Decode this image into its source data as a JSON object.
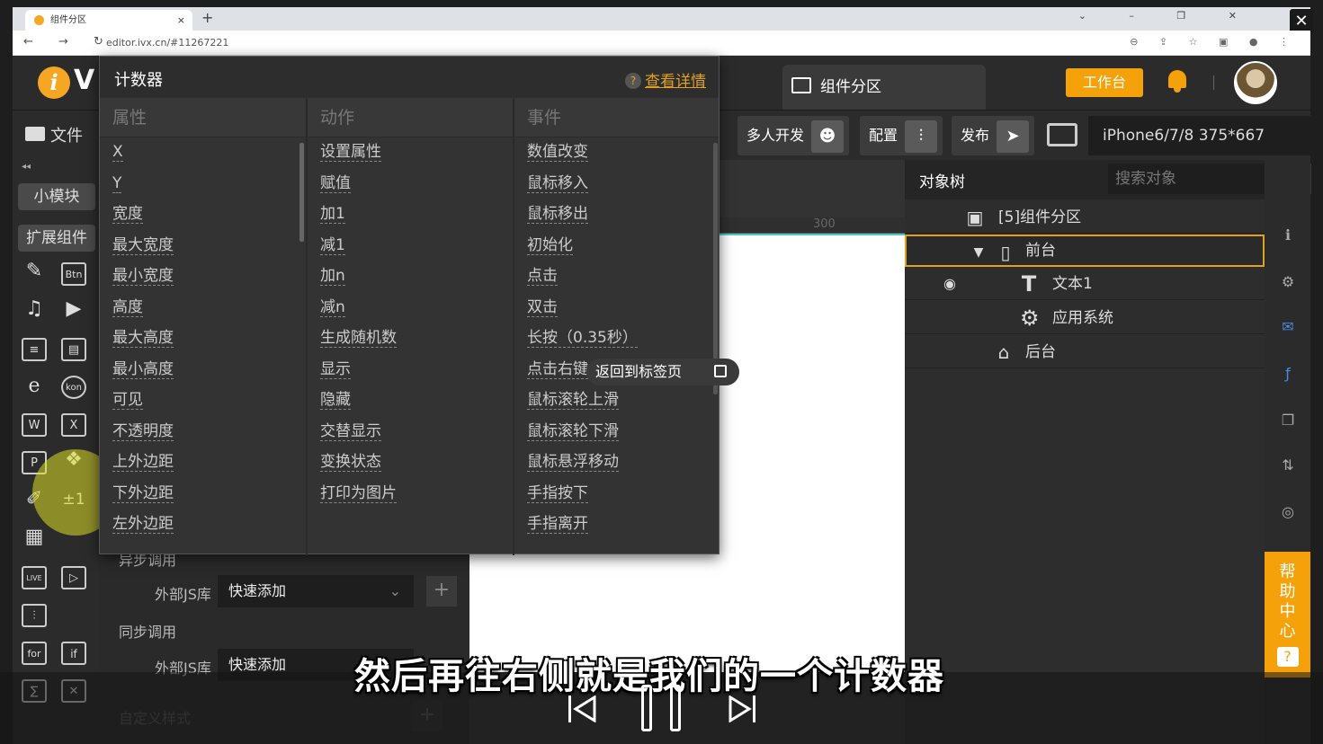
{
  "browser": {
    "tab_title": "组件分区",
    "tab_close": "×",
    "new_tab": "+",
    "window_controls": "⌄ – ❐ ✕",
    "nav_icons": "← → ↻",
    "url": "editor.ivx.cn/#11267221",
    "addr_icons": "⊖ ⇪ ☆ ▣ ● ⋮"
  },
  "app": {
    "logo": "i",
    "logo_tail": "V",
    "component_tab": "组件分区",
    "workbench": "工作台"
  },
  "toolbar": {
    "file": "文件",
    "multi_dev": "多人开发",
    "config": "配置",
    "publish": "发布",
    "device": "iPhone6/7/8 375*667"
  },
  "leftbar": {
    "collapse": "◂◂",
    "small_module": "小模块",
    "extend": "扩展组件",
    "icons": [
      "pen-icon",
      "button-icon",
      "music-icon",
      "video-icon",
      "text-icon",
      "image-text-icon",
      "ie-icon",
      "icon-font-icon",
      "word-icon",
      "excel-icon",
      "ppt-icon",
      "link-icon",
      "draw-icon",
      "counter-icon",
      "qr-icon",
      "live-icon",
      "player-icon",
      "sliders-icon",
      "for-icon",
      "if-icon"
    ],
    "labels": {
      "btn": "Btn",
      "kon": "kon",
      "w": "W",
      "x": "X",
      "p": "P",
      "live": "LIVE",
      "for": "for",
      "if": "if",
      "pm": "±1"
    }
  },
  "props": {
    "async_call": "异步调用",
    "sync_call": "同步调用",
    "ext_js_1": "外部JS库",
    "ext_js_2": "外部JS库",
    "quick_add_1": "快速添加",
    "quick_add_2": "快速添加",
    "custom_style": "自定义样式",
    "plus": "+",
    "dropdown": "⌄"
  },
  "canvas": {
    "ruler_label": "300"
  },
  "tree": {
    "title": "对象树",
    "search_placeholder": "搜索对象",
    "rows": [
      {
        "label": "[5]组件分区"
      },
      {
        "label": "前台"
      },
      {
        "label": "文本1"
      },
      {
        "label": "应用系统"
      },
      {
        "label": "后台"
      }
    ]
  },
  "help": {
    "text": "帮助中心",
    "q": "?"
  },
  "popup": {
    "title": "计数器",
    "help_link": "查看详情",
    "col_props": "属性",
    "col_actions": "动作",
    "col_events": "事件",
    "props": [
      "X",
      "Y",
      "宽度",
      "最大宽度",
      "最小宽度",
      "高度",
      "最大高度",
      "最小高度",
      "可见",
      "不透明度",
      "上外边距",
      "下外边距",
      "左外边距"
    ],
    "actions": [
      "设置属性",
      "赋值",
      "加1",
      "减1",
      "加n",
      "减n",
      "生成随机数",
      "显示",
      "隐藏",
      "交替显示",
      "变换状态",
      "打印为图片"
    ],
    "events": [
      "数值改变",
      "鼠标移入",
      "鼠标移出",
      "初始化",
      "点击",
      "双击",
      "长按（0.35秒）",
      "点击右键",
      "鼠标滚轮上滑",
      "鼠标滚轮下滑",
      "鼠标悬浮移动",
      "手指按下",
      "手指离开"
    ]
  },
  "tooltip": {
    "text": "返回到标签页"
  },
  "video": {
    "subtitle": "然后再往右侧就是我们的一个计数器"
  }
}
